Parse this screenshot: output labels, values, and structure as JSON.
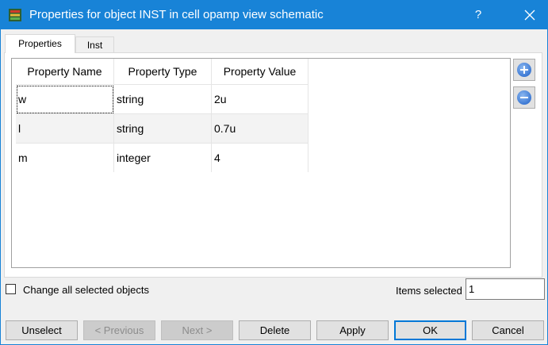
{
  "window": {
    "title": "Properties for object INST in cell opamp view schematic",
    "help_label": "?"
  },
  "tabs": [
    {
      "label": "Properties",
      "active": true
    },
    {
      "label": "Inst",
      "active": false
    }
  ],
  "table": {
    "headers": [
      "Property Name",
      "Property Type",
      "Property Value"
    ],
    "rows": [
      [
        "w",
        "string",
        "2u"
      ],
      [
        "l",
        "string",
        "0.7u"
      ],
      [
        "m",
        "integer",
        "4"
      ]
    ]
  },
  "side_buttons": {
    "add_icon": "plus-circle-icon",
    "remove_icon": "minus-circle-icon"
  },
  "footer": {
    "change_all_label": "Change all selected objects",
    "change_all_checked": false,
    "items_selected_label": "Items selected",
    "items_selected_value": "1"
  },
  "buttons": {
    "unselect": "Unselect",
    "previous": "< Previous",
    "next": "Next >",
    "delete": "Delete",
    "apply": "Apply",
    "ok": "OK",
    "cancel": "Cancel"
  },
  "colors": {
    "titlebar": "#1883d7",
    "accent": "#0078d7"
  }
}
